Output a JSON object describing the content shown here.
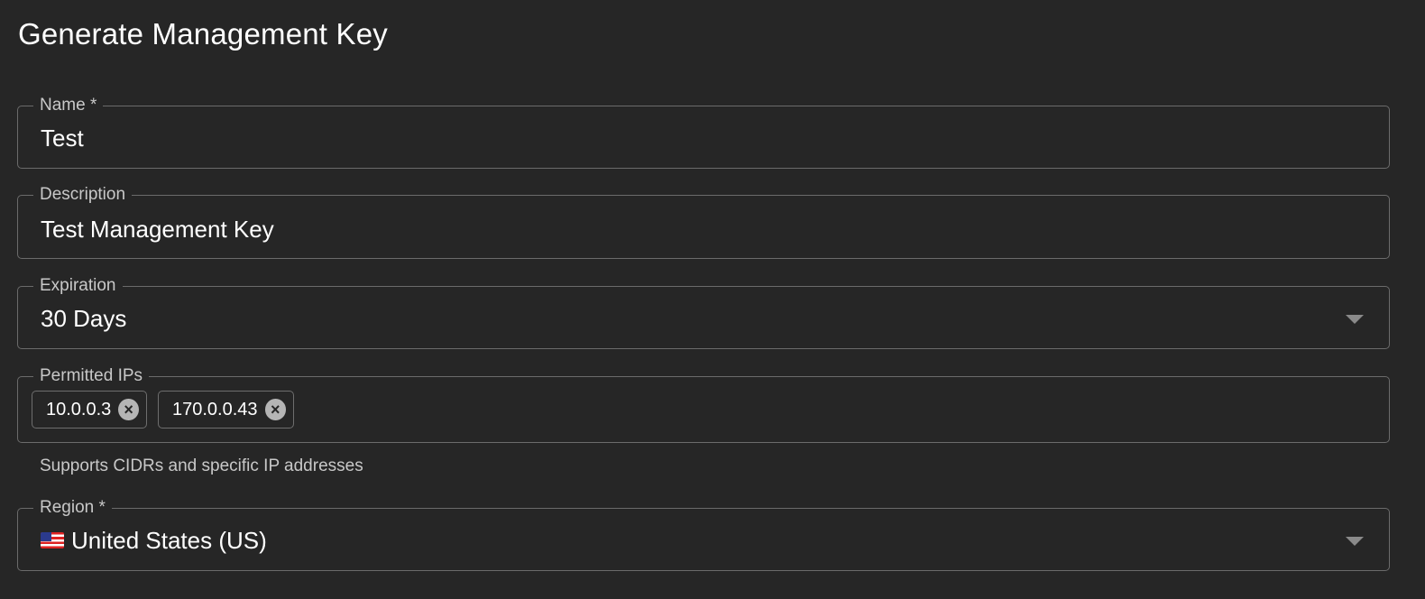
{
  "title": "Generate Management Key",
  "name_field": {
    "label": "Name *",
    "value": "Test"
  },
  "description_field": {
    "label": "Description",
    "value": "Test Management Key"
  },
  "expiration_field": {
    "label": "Expiration",
    "selected": "30 Days"
  },
  "permitted_ips_field": {
    "label": "Permitted IPs",
    "chips": [
      "10.0.0.3",
      "170.0.0.43"
    ],
    "remove_icon": "close-circle-icon",
    "helper_text": "Supports CIDRs and specific IP addresses"
  },
  "region_field": {
    "label": "Region *",
    "flag_icon": "us-flag-icon",
    "selected": "United States (US)"
  },
  "colors": {
    "background": "#262626",
    "border": "#6b6b6b",
    "label": "#c8c8c8",
    "text": "#ffffff"
  }
}
